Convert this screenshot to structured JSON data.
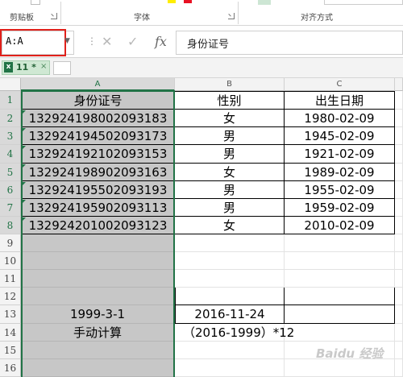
{
  "ribbon": {
    "groups": [
      {
        "label": "剪贴板"
      },
      {
        "label": "字体"
      },
      {
        "label": "对齐方式"
      }
    ]
  },
  "name_box": {
    "value": "A:A"
  },
  "formula_bar": {
    "cancel_icon": "✕",
    "enter_icon": "✓",
    "fx_label": "fx",
    "content": "身份证号"
  },
  "doc_tab": {
    "icon": "x",
    "label": "11 *",
    "close": "×"
  },
  "columns": [
    "A",
    "B",
    "C"
  ],
  "rows": [
    "1",
    "2",
    "3",
    "4",
    "5",
    "6",
    "7",
    "8",
    "9",
    "10",
    "11",
    "12",
    "13",
    "14",
    "15",
    "16"
  ],
  "table": {
    "headers": [
      "身份证号",
      "性别",
      "出生日期"
    ],
    "records": [
      [
        "132924198002093183",
        "女",
        "1980-02-09"
      ],
      [
        "132924194502093173",
        "男",
        "1945-02-09"
      ],
      [
        "132924192102093153",
        "男",
        "1921-02-09"
      ],
      [
        "132924198902093163",
        "女",
        "1989-02-09"
      ],
      [
        "132924195502093193",
        "男",
        "1955-02-09"
      ],
      [
        "132924195902093113",
        "男",
        "1959-02-09"
      ],
      [
        "132924201002093123",
        "女",
        "2010-02-09"
      ]
    ]
  },
  "row13": {
    "a": "1999-3-1",
    "b": "2016-11-24"
  },
  "row14": {
    "a": "手动计算",
    "b": "（2016-1999）*12"
  },
  "watermark": "Baidu 经验",
  "colors": {
    "excel_green": "#217346",
    "selection_gray": "#c7c7c7",
    "highlight_red": "#e0201a"
  }
}
